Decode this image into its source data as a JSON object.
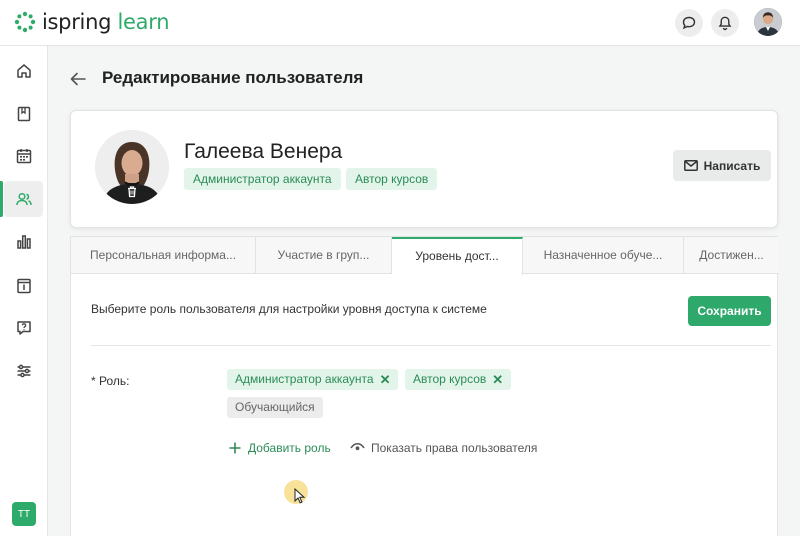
{
  "brand": {
    "logo_part1": "ispring",
    "logo_part2": " learn",
    "accent_color": "#2eab6a"
  },
  "header": {
    "icons": [
      "chat-bubble-icon",
      "bell-icon"
    ],
    "avatar": "user-avatar"
  },
  "sidebar": {
    "items": [
      "home-icon",
      "book-icon",
      "calendar-icon",
      "users-icon",
      "bar-chart-icon",
      "info-panel-icon",
      "question-icon",
      "sliders-icon"
    ],
    "active_index": 3,
    "user_initials": "TT"
  },
  "page": {
    "title": "Редактирование пользователя"
  },
  "profile": {
    "name": "Галеева Венера",
    "roles": [
      "Администратор аккаунта",
      "Автор курсов"
    ],
    "write_label": "Написать"
  },
  "tabs": [
    {
      "label": "Персональная информа...",
      "active": false
    },
    {
      "label": "Участие в груп...",
      "active": false
    },
    {
      "label": "Уровень дост...",
      "active": true
    },
    {
      "label": "Назначенное обуче...",
      "active": false
    },
    {
      "label": "Достижен...",
      "active": false
    }
  ],
  "access": {
    "hint": "Выберите роль пользователя для настройки уровня доступа к системе",
    "save_label": "Сохранить",
    "role_label": "* Роль:",
    "selected_roles": [
      "Администратор аккаунта",
      "Автор курсов"
    ],
    "default_role": "Обучающийся",
    "add_role_label": "Добавить роль",
    "show_rights_label": "Показать права пользователя"
  }
}
